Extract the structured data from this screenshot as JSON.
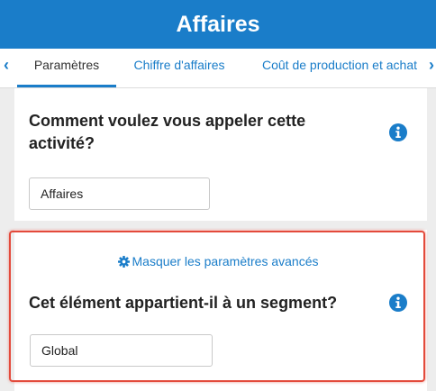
{
  "header": {
    "title": "Affaires"
  },
  "tabs": [
    {
      "label": "Paramètres",
      "active": true
    },
    {
      "label": "Chiffre d'affaires",
      "active": false
    },
    {
      "label": "Coût de production et achat",
      "active": false
    }
  ],
  "nav": {
    "prev_icon": "chevron-left-icon",
    "next_icon": "chevron-right-icon"
  },
  "activity": {
    "question": "Comment voulez vous appeler cette activité?",
    "value": "Affaires",
    "icon": "info-icon"
  },
  "advanced": {
    "toggle_label": "Masquer les paramètres avancés",
    "icon": "gear-icon"
  },
  "segment": {
    "question": "Cet élément appartient-il à un segment?",
    "value": "Global",
    "icon": "info-icon"
  },
  "colors": {
    "accent": "#1a7dc9",
    "highlight": "#e34a3b"
  }
}
